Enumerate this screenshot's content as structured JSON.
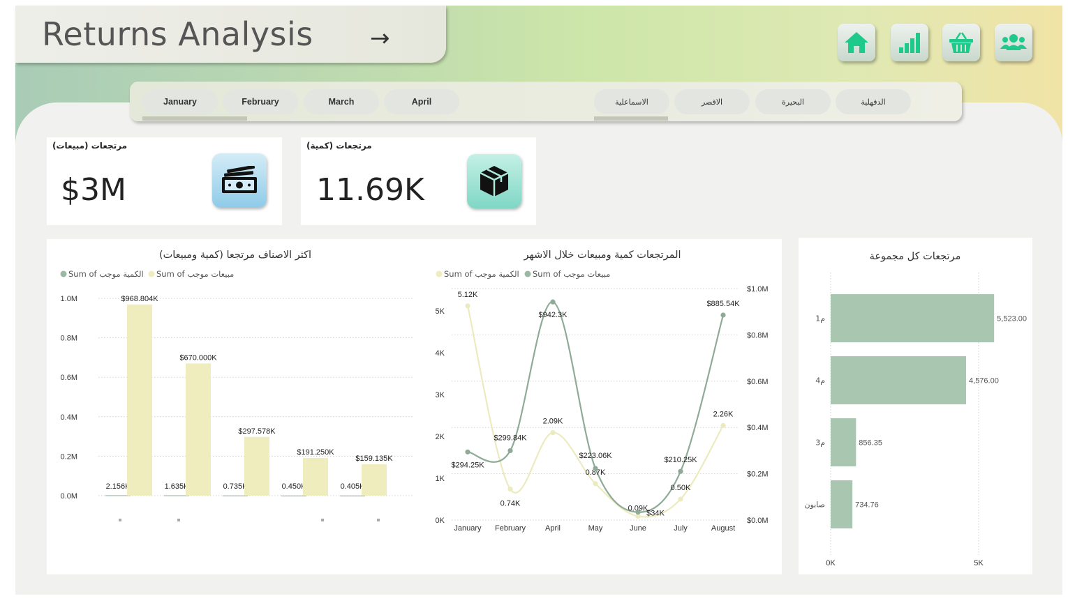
{
  "header": {
    "title": "Returns Analysis",
    "arrow": "→"
  },
  "nav": {
    "buttons": [
      {
        "name": "home-icon"
      },
      {
        "name": "bar-chart-icon"
      },
      {
        "name": "basket-icon"
      },
      {
        "name": "users-icon"
      }
    ]
  },
  "slicers": {
    "months": [
      "January",
      "February",
      "March",
      "April"
    ],
    "branches": [
      "الاسماعلية",
      "الاقصر",
      "البحيرة",
      "الدقهلية"
    ]
  },
  "kpis": [
    {
      "label": "مرتجعات (مبيعات)",
      "value": "$3M",
      "icon": "cash-icon",
      "iconColor": "#b6dcf0"
    },
    {
      "label": "مرتجعات (كمية)",
      "value": "11.69K",
      "icon": "box-icon",
      "iconColor": "#9fe0d4"
    }
  ],
  "colors": {
    "green": "#9ab8a3",
    "yellow": "#efedbd",
    "barGreen": "#a9c6b1"
  },
  "chart_data": [
    {
      "type": "bar",
      "title": "اكثر الاصناف مرتجعا (كمية ومبيعات)",
      "legend": [
        "Sum of الكمية موجب",
        "Sum of مبيعات موجب"
      ],
      "legendPlacement": "top-left",
      "ylim": [
        0,
        1000000
      ],
      "yticks": [
        "0.0M",
        "0.2M",
        "0.4M",
        "0.6M",
        "0.8M",
        "1.0M"
      ],
      "series": [
        {
          "name": "Sum of الكمية موجب",
          "values": [
            2156,
            1635,
            735,
            450,
            405
          ],
          "labels": [
            "2.156K",
            "1.635K",
            "0.735K",
            "0.450K",
            "0.405K"
          ]
        },
        {
          "name": "Sum of مبيعات موجب",
          "values": [
            968804,
            670000,
            297578,
            191250,
            159135
          ],
          "labels": [
            "$968.804K",
            "$670.000K",
            "$297.578K",
            "$191.250K",
            "$159.135K"
          ]
        }
      ]
    },
    {
      "type": "line",
      "title": "المرتجعات كمية ومبيعات خلال الاشهر",
      "legend": [
        "Sum of الكمية موجب",
        "Sum of مبيعات موجب"
      ],
      "legendPlacement": "top-left",
      "categories": [
        "January",
        "February",
        "April",
        "May",
        "June",
        "July",
        "August"
      ],
      "leftTicks": [
        "0K",
        "1K",
        "2K",
        "3K",
        "4K",
        "5K"
      ],
      "rightTicks": [
        "$0.0M",
        "$0.2M",
        "$0.4M",
        "$0.6M",
        "$0.8M",
        "$1.0M"
      ],
      "ylimLeft": [
        0,
        5500
      ],
      "ylimRight": [
        0,
        1000000
      ],
      "series": [
        {
          "name": "Sum of الكمية موجب",
          "axis": "left",
          "values": [
            5120,
            740,
            2090,
            870,
            90,
            500,
            2260
          ],
          "labels": [
            "5.12K",
            "0.74K",
            "2.09K",
            "0.87K",
            "0.09K",
            "0.50K",
            "2.26K"
          ]
        },
        {
          "name": "Sum of مبيعات موجب",
          "axis": "right",
          "values": [
            294250,
            299840,
            942300,
            223060,
            34000,
            210250,
            885540
          ],
          "labels": [
            "$294.25K",
            "$299.84K",
            "$942.3K",
            "$223.06K",
            "$34K",
            "$210.25K",
            "$885.54K"
          ]
        }
      ]
    },
    {
      "type": "bar",
      "orientation": "horizontal",
      "title": "مرتجعات كل مجموعة",
      "categories": [
        "م1",
        "م4",
        "م3",
        "صابون"
      ],
      "values": [
        5523.0,
        4576.0,
        856.35,
        734.76
      ],
      "labels": [
        "5,523.00",
        "4,576.00",
        "856.35",
        "734.76"
      ],
      "xticks": [
        "0K",
        "5K"
      ],
      "xlim": [
        0,
        6140
      ]
    }
  ]
}
